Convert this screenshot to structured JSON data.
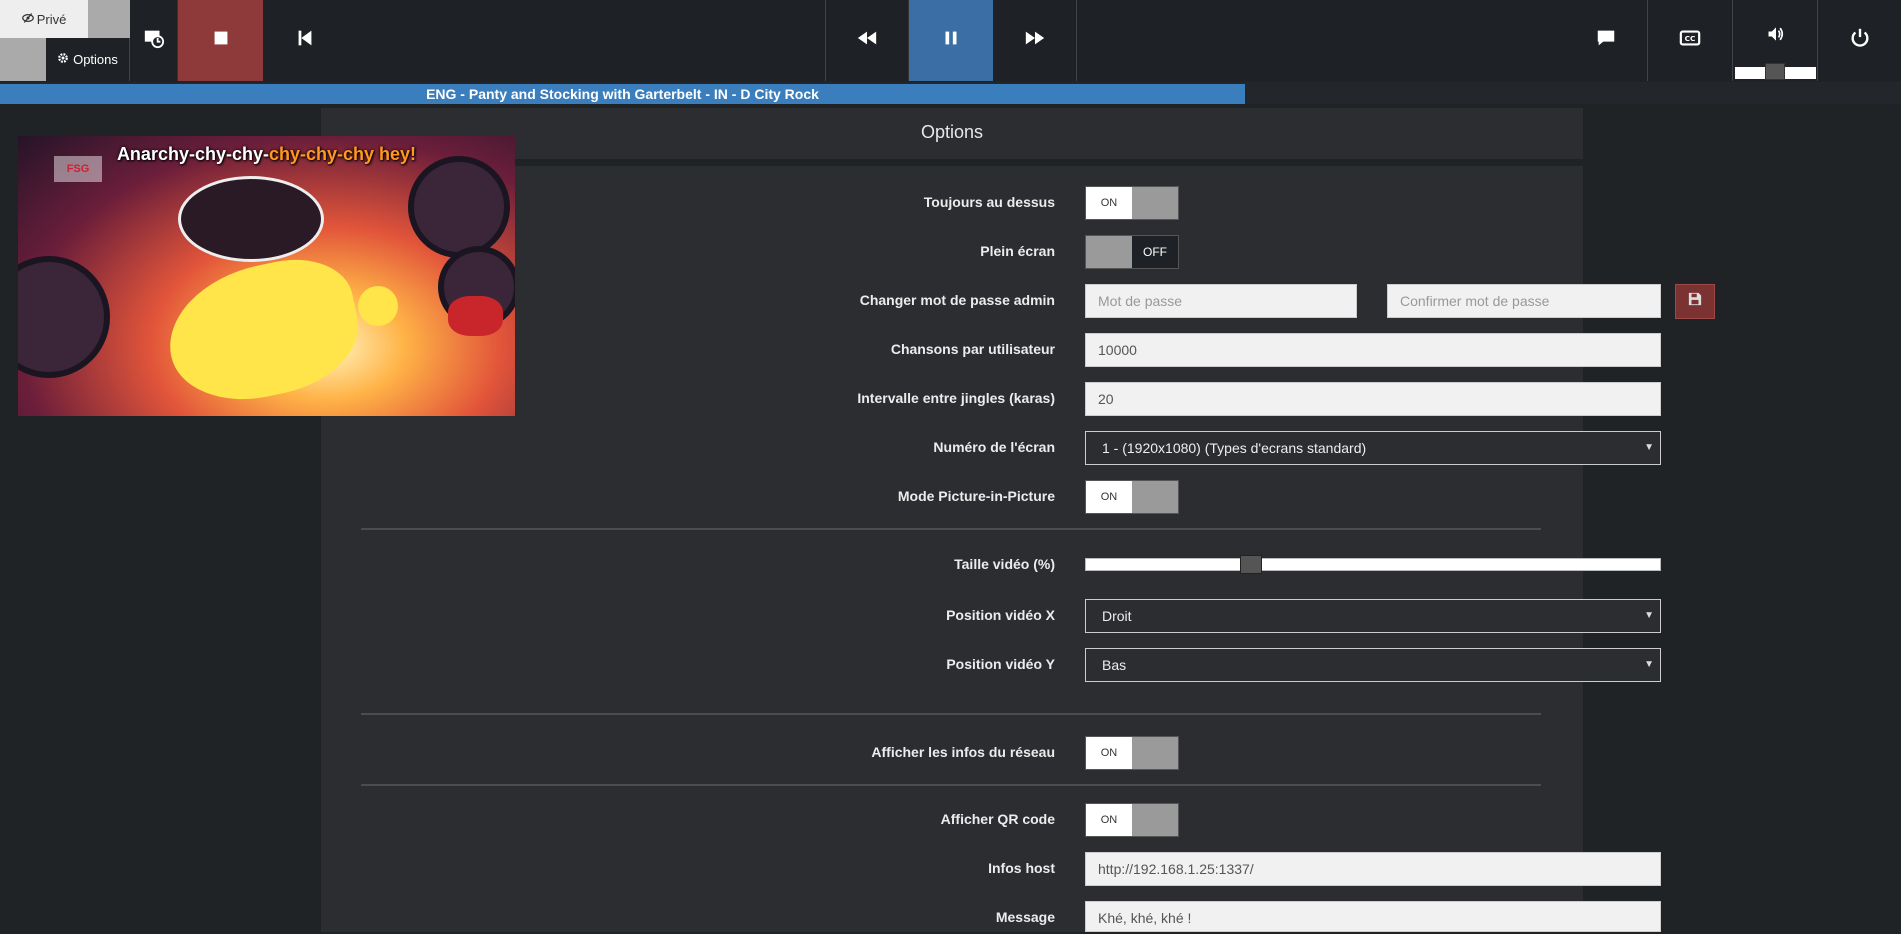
{
  "topbar": {
    "prive_label": "Privé",
    "options_label": "Options",
    "colors": {
      "stop": "#8f3a3a",
      "pause_active": "#3a6ea5",
      "bg": "#1e2125"
    }
  },
  "now_playing": {
    "title": "ENG - Panty and Stocking with Garterbelt - IN - D City Rock",
    "progress": 0.655
  },
  "video": {
    "lyrics_sung": "Anarchy-chy-chy-",
    "lyrics_pending": "chy-chy-chy hey!"
  },
  "options": {
    "header": "Options",
    "always_on_top": {
      "label": "Toujours au dessus",
      "state": "ON"
    },
    "fullscreen": {
      "label": "Plein écran",
      "state": "OFF"
    },
    "admin_password": {
      "label": "Changer mot de passe admin",
      "placeholder": "Mot de passe",
      "confirm_placeholder": "Confirmer mot de passe"
    },
    "songs_per_user": {
      "label": "Chansons par utilisateur",
      "value": "10000"
    },
    "jingle_interval": {
      "label": "Intervalle entre jingles (karas)",
      "value": "20"
    },
    "screen_number": {
      "label": "Numéro de l'écran",
      "value": "1 - (1920x1080) (Types d'ecrans standard)"
    },
    "pip_mode": {
      "label": "Mode Picture-in-Picture",
      "state": "ON"
    },
    "video_size": {
      "label": "Taille vidéo (%)",
      "value_fraction": 0.28
    },
    "video_pos_x": {
      "label": "Position vidéo X",
      "value": "Droit"
    },
    "video_pos_y": {
      "label": "Position vidéo Y",
      "value": "Bas"
    },
    "network_info": {
      "label": "Afficher les infos du réseau",
      "state": "ON"
    },
    "qr_code": {
      "label": "Afficher QR code",
      "state": "ON"
    },
    "host_info": {
      "label": "Infos host",
      "value": "http://192.168.1.25:1337/"
    },
    "message": {
      "label": "Message",
      "value": "Khé, khé, khé !"
    }
  }
}
